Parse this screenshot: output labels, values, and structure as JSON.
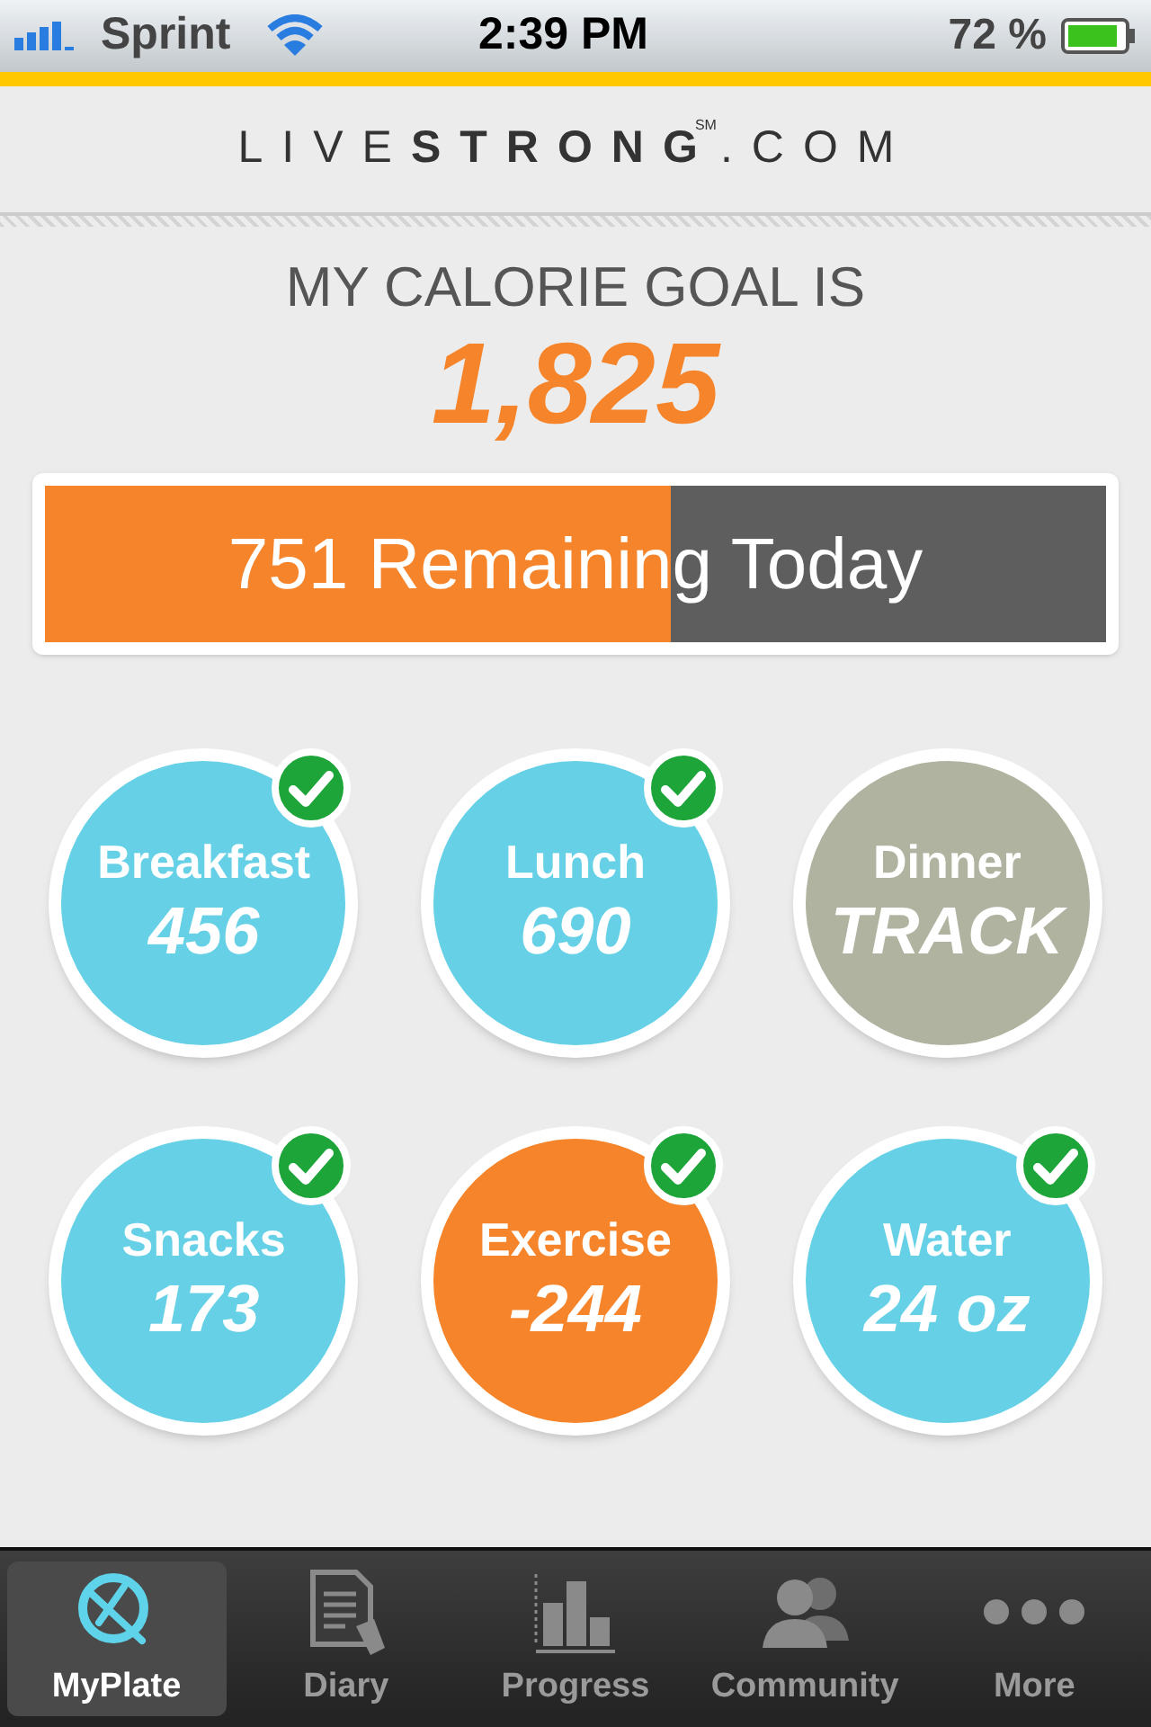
{
  "status_bar": {
    "carrier": "Sprint",
    "time": "2:39 PM",
    "battery": "72 %"
  },
  "logo": {
    "light": "LIVE",
    "bold": "STRONG",
    "mark": "SM",
    "suffix": ".COM"
  },
  "goal": {
    "label": "MY CALORIE GOAL IS",
    "value": "1,825"
  },
  "remaining": {
    "text": "751 Remaining Today",
    "level": 0.59
  },
  "meals": [
    {
      "label": "Breakfast",
      "value": "456",
      "color": "#66d1e6",
      "checked": true
    },
    {
      "label": "Lunch",
      "value": "690",
      "color": "#66d1e6",
      "checked": true
    },
    {
      "label": "Dinner",
      "value": "TRACK",
      "color": "#b0b3a0",
      "checked": false
    },
    {
      "label": "Snacks",
      "value": "173",
      "color": "#66d1e6",
      "checked": true
    },
    {
      "label": "Exercise",
      "value": "-244",
      "color": "#f5842a",
      "checked": true
    },
    {
      "label": "Water",
      "value": "24 oz",
      "color": "#66d1e6",
      "checked": true
    }
  ],
  "tabs": [
    {
      "label": "MyPlate",
      "kind": "plate",
      "selected": true
    },
    {
      "label": "Diary",
      "kind": "diary",
      "selected": false
    },
    {
      "label": "Progress",
      "kind": "chart",
      "selected": false
    },
    {
      "label": "Community",
      "kind": "people",
      "selected": false
    },
    {
      "label": "More",
      "kind": "more",
      "selected": false
    }
  ]
}
